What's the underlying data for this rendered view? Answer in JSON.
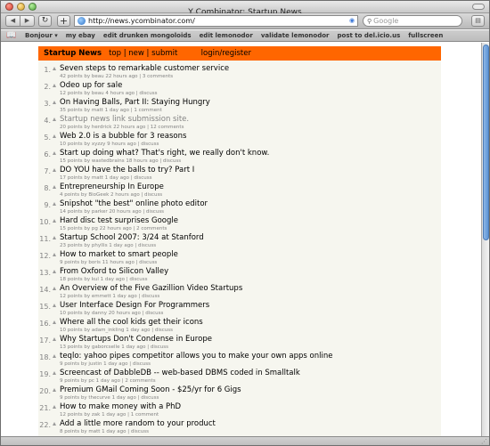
{
  "window": {
    "title": "Y Combinator: Startup News"
  },
  "toolbar": {
    "back_icon": "back-arrow-icon",
    "forward_icon": "forward-arrow-icon",
    "reload_glyph": "↻",
    "add_glyph": "+",
    "url": "http://news.ycombinator.com/",
    "search_placeholder": "Google"
  },
  "bookmarks": {
    "items": [
      "Bonjour ▾",
      "my ebay",
      "edit drunken mongoloids",
      "edit lemonodor",
      "validate lemonodor",
      "post to del.icio.us",
      "fullscreen"
    ]
  },
  "hn": {
    "site_title": "Startup News",
    "nav_top": "top",
    "nav_sep1": " | ",
    "nav_new": "new",
    "nav_sep2": " | ",
    "nav_submit": "submit",
    "login": "login/register",
    "header_color": "#ff6600",
    "background": "#f6f6ef"
  },
  "stories": [
    {
      "rank": "1.",
      "title": "Seven steps to remarkable customer service",
      "subtext": "42 points by beau 22 hours ago | 3 comments"
    },
    {
      "rank": "2.",
      "title": "Odeo up for sale",
      "subtext": "12 points by beau 4 hours ago | discuss"
    },
    {
      "rank": "3.",
      "title": "On Having Balls, Part II: Staying Hungry",
      "subtext": "35 points by matt 1 day ago | 1 comment"
    },
    {
      "rank": "4.",
      "title": "Startup news link submission site.",
      "subtext": "20 points by herdrick 22 hours ago | 12 comments",
      "visited": true
    },
    {
      "rank": "5.",
      "title": "Web 2.0 is a bubble for 3 reasons",
      "subtext": "10 points by xyzzy 9 hours ago | discuss"
    },
    {
      "rank": "6.",
      "title": "Start up doing what? That's right, we really don't know.",
      "subtext": "15 points by wastedbrains 18 hours ago | discuss"
    },
    {
      "rank": "7.",
      "title": "DO YOU have the balls to try? Part I",
      "subtext": "17 points by matt 1 day ago | discuss"
    },
    {
      "rank": "8.",
      "title": "Entrepreneurship In Europe",
      "subtext": "4 points by BioGeek 2 hours ago | discuss"
    },
    {
      "rank": "9.",
      "title": "Snipshot \"the best\" online photo editor",
      "subtext": "14 points by parker 20 hours ago | discuss"
    },
    {
      "rank": "10.",
      "title": "Hard disc test surprises Google",
      "subtext": "15 points by pg 22 hours ago | 2 comments"
    },
    {
      "rank": "11.",
      "title": "Startup School 2007: 3/24 at Stanford",
      "subtext": "23 points by phyllis 1 day ago | discuss"
    },
    {
      "rank": "12.",
      "title": "How to market to smart people",
      "subtext": "9 points by boris 11 hours ago | discuss"
    },
    {
      "rank": "13.",
      "title": "From Oxford to Silicon Valley",
      "subtext": "18 points by kul 1 day ago | discuss"
    },
    {
      "rank": "14.",
      "title": "An Overview of the Five Gazillion Video Startups",
      "subtext": "12 points by emmett 1 day ago | discuss"
    },
    {
      "rank": "15.",
      "title": "User Interface Design For Programmers",
      "subtext": "10 points by danny 20 hours ago | discuss"
    },
    {
      "rank": "16.",
      "title": "Where all the cool kids get their icons",
      "subtext": "10 points by adam_inkling 1 day ago | discuss"
    },
    {
      "rank": "17.",
      "title": "Why Startups Don't Condense in Europe",
      "subtext": "13 points by gaborcselle 1 day ago | discuss"
    },
    {
      "rank": "18.",
      "title": "teqlo: yahoo pipes competitor allows you to make your own apps online",
      "subtext": "9 points by justin 1 day ago | discuss"
    },
    {
      "rank": "19.",
      "title": "Screencast of DabbleDB -- web-based DBMS coded in Smalltalk",
      "subtext": "9 points by pc 1 day ago | 2 comments"
    },
    {
      "rank": "20.",
      "title": "Premium GMail Coming Soon - $25/yr for 6 Gigs",
      "subtext": "9 points by thecurve 1 day ago | discuss"
    },
    {
      "rank": "21.",
      "title": "How to make money with a PhD",
      "subtext": "12 points by zak 1 day ago | 1 comment"
    },
    {
      "rank": "22.",
      "title": "Add a little more random to your product",
      "subtext": "8 points by matt 1 day ago | discuss"
    }
  ]
}
